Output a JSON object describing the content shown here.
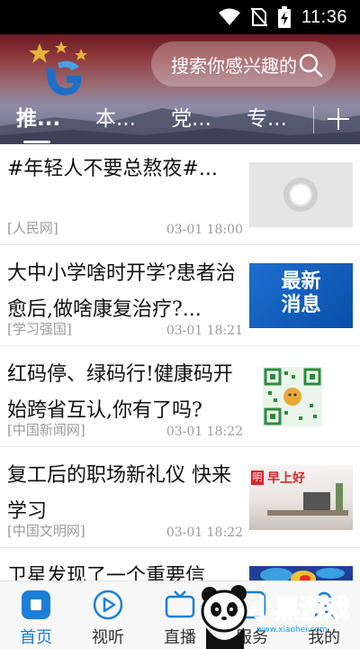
{
  "status_bar": {
    "time": "11:36",
    "icons": [
      "wifi-icon",
      "no-sim-icon",
      "battery-charging-icon"
    ]
  },
  "header": {
    "search_placeholder": "搜索你感兴趣的",
    "tabs": [
      {
        "label": "推...",
        "active": true
      },
      {
        "label": "本..."
      },
      {
        "label": "党..."
      },
      {
        "label": "专..."
      }
    ],
    "add_tab_icon": "plus-icon"
  },
  "feed": [
    {
      "title": "#年轻人不要总熬夜#...",
      "source": "[人民网]",
      "time": "03-01 18:00",
      "thumb": "loading-placeholder"
    },
    {
      "title": "大中小学啥时开学?患者治愈后,做啥康复治疗?...",
      "source": "[学习强国]",
      "time": "03-01 18:21",
      "thumb": "最新消息"
    },
    {
      "title": "红码停、绿码行!健康码开始跨省互认,你有了吗?",
      "source": "[中国新闻网]",
      "time": "03-01 18:22",
      "thumb": "qr-code"
    },
    {
      "title": "复工后的职场新礼仪 快来学习",
      "source": "[中国文明网]",
      "time": "03-01 18:22",
      "thumb": "早上好"
    },
    {
      "title": "卫星发现了一个重要信",
      "source": "",
      "time": "",
      "thumb": "heatmap"
    }
  ],
  "thumb_texts": {
    "news_line1": "最新",
    "news_line2": "消息",
    "morning_logo": "早上好",
    "morning_small": "明"
  },
  "bottom_nav": [
    {
      "label": "首页",
      "icon": "home-icon",
      "active": true
    },
    {
      "label": "视听",
      "icon": "play-icon"
    },
    {
      "label": "直播",
      "icon": "live-tv-icon"
    },
    {
      "label": "服务",
      "icon": "service-icon"
    },
    {
      "label": "我的",
      "icon": "profile-icon"
    }
  ],
  "watermark": {
    "text": "小黑游戏",
    "url": "www.xiaohei.com"
  },
  "colors": {
    "accent": "#1b7fd6",
    "header_red": "#8f3b3e",
    "text": "#111111",
    "meta": "#9b9b9b"
  }
}
